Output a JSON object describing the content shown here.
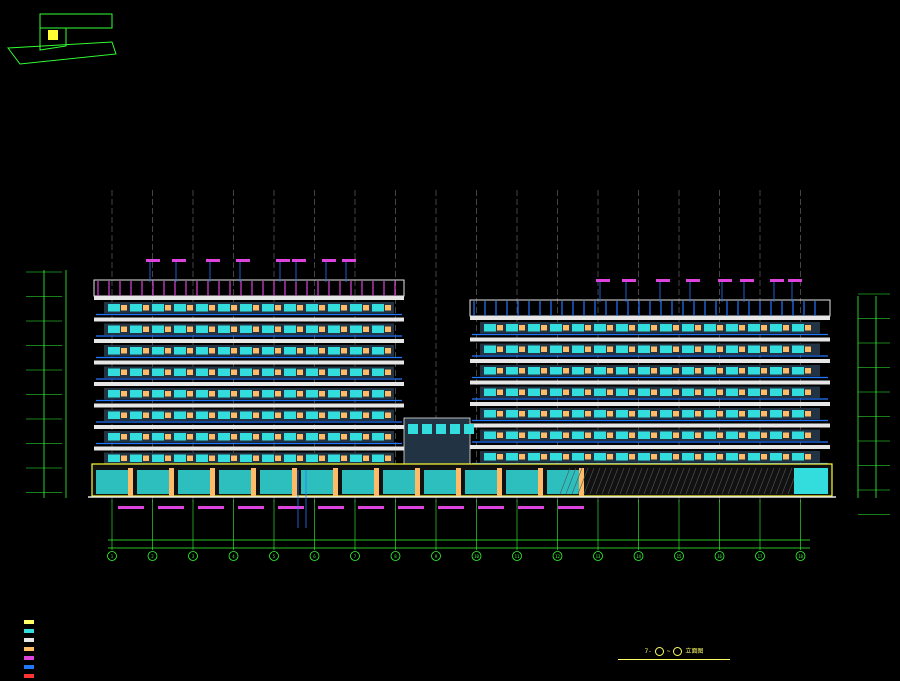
{
  "drawing": {
    "title_prefix": "7-",
    "title_suffix": "立面图",
    "background": "#000000"
  },
  "colors": {
    "frame_green": "#33ff33",
    "slab_white": "#e6e6e6",
    "glass_cyan": "#33dddd",
    "panel_orange": "#ffbb66",
    "mullion_blue": "#2277ff",
    "accent_magenta": "#dd44dd",
    "base_yellow": "#ffff33",
    "axis_gray": "#888888"
  },
  "elevation": {
    "left_block_floors": 8,
    "right_block_floors": 7,
    "axis_count": 18,
    "axis_labels": [
      "1",
      "2",
      "3",
      "4",
      "5",
      "6",
      "7",
      "8",
      "9",
      "10",
      "11",
      "12",
      "13",
      "14",
      "15",
      "16",
      "17",
      "18"
    ]
  },
  "legend": {
    "items": [
      {
        "color": "#ffff66",
        "label": ""
      },
      {
        "color": "#33dddd",
        "label": ""
      },
      {
        "color": "#e6e6e6",
        "label": ""
      },
      {
        "color": "#ffbb66",
        "label": ""
      },
      {
        "color": "#dd44dd",
        "label": ""
      },
      {
        "color": "#2277ff",
        "label": ""
      },
      {
        "color": "#ff3333",
        "label": ""
      }
    ]
  }
}
